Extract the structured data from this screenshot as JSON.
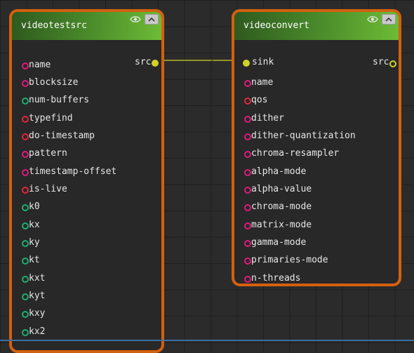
{
  "nodes": {
    "videotestsrc": {
      "title": "videotestsrc",
      "visibility_icon": "eye-icon",
      "collapse_icon": "chevron-up-icon",
      "src_pad": "src",
      "properties": [
        {
          "name": "name",
          "color": "pink"
        },
        {
          "name": "blocksize",
          "color": "pink"
        },
        {
          "name": "num-buffers",
          "color": "green"
        },
        {
          "name": "typefind",
          "color": "red"
        },
        {
          "name": "do-timestamp",
          "color": "red"
        },
        {
          "name": "pattern",
          "color": "pink"
        },
        {
          "name": "timestamp-offset",
          "color": "pink"
        },
        {
          "name": "is-live",
          "color": "red"
        },
        {
          "name": "k0",
          "color": "green"
        },
        {
          "name": "kx",
          "color": "green"
        },
        {
          "name": "ky",
          "color": "green"
        },
        {
          "name": "kt",
          "color": "green"
        },
        {
          "name": "kxt",
          "color": "green"
        },
        {
          "name": "kyt",
          "color": "green"
        },
        {
          "name": "kxy",
          "color": "green"
        },
        {
          "name": "kx2",
          "color": "green"
        }
      ]
    },
    "videoconvert": {
      "title": "videoconvert",
      "visibility_icon": "eye-icon",
      "collapse_icon": "chevron-up-icon",
      "sink_pad": "sink",
      "src_pad": "src",
      "properties": [
        {
          "name": "name",
          "color": "pink"
        },
        {
          "name": "qos",
          "color": "red"
        },
        {
          "name": "dither",
          "color": "pink"
        },
        {
          "name": "dither-quantization",
          "color": "pink"
        },
        {
          "name": "chroma-resampler",
          "color": "pink"
        },
        {
          "name": "alpha-mode",
          "color": "pink"
        },
        {
          "name": "alpha-value",
          "color": "pink"
        },
        {
          "name": "chroma-mode",
          "color": "pink"
        },
        {
          "name": "matrix-mode",
          "color": "pink"
        },
        {
          "name": "gamma-mode",
          "color": "pink"
        },
        {
          "name": "primaries-mode",
          "color": "pink"
        },
        {
          "name": "n-threads",
          "color": "pink"
        }
      ]
    }
  },
  "colors": {
    "node_border": "#d4600f",
    "header_gradient_start": "#2f5a1f",
    "header_gradient_end": "#6dbb36",
    "pad": "#d2d229",
    "prop_pink": "#e0197d",
    "prop_green": "#1cae72",
    "prop_red": "#e0263a"
  }
}
